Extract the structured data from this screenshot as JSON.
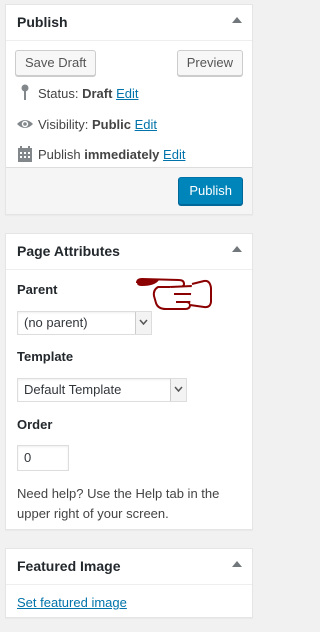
{
  "publish": {
    "title": "Publish",
    "save_draft": "Save Draft",
    "preview": "Preview",
    "status_label": "Status:",
    "status_value": "Draft",
    "visibility_label": "Visibility:",
    "visibility_value": "Public",
    "publish_label": "Publish",
    "publish_value": "immediately",
    "edit": "Edit",
    "publish_button": "Publish"
  },
  "page_attributes": {
    "title": "Page Attributes",
    "parent_label": "Parent",
    "parent_selected": "(no parent)",
    "template_label": "Template",
    "template_selected": "Default Template",
    "order_label": "Order",
    "order_value": "0",
    "help_text": "Need help? Use the Help tab in the upper right of your screen."
  },
  "featured_image": {
    "title": "Featured Image",
    "set_link": "Set featured image"
  },
  "icons": [
    "pin-icon",
    "eye-icon",
    "calendar-icon",
    "pointing-hand-icon",
    "toggle-arrow-icon",
    "select-arrow-icon"
  ],
  "colors": {
    "link": "#0073aa",
    "primary_button": "#0085ba",
    "hand_annotation": "#8b0000"
  }
}
